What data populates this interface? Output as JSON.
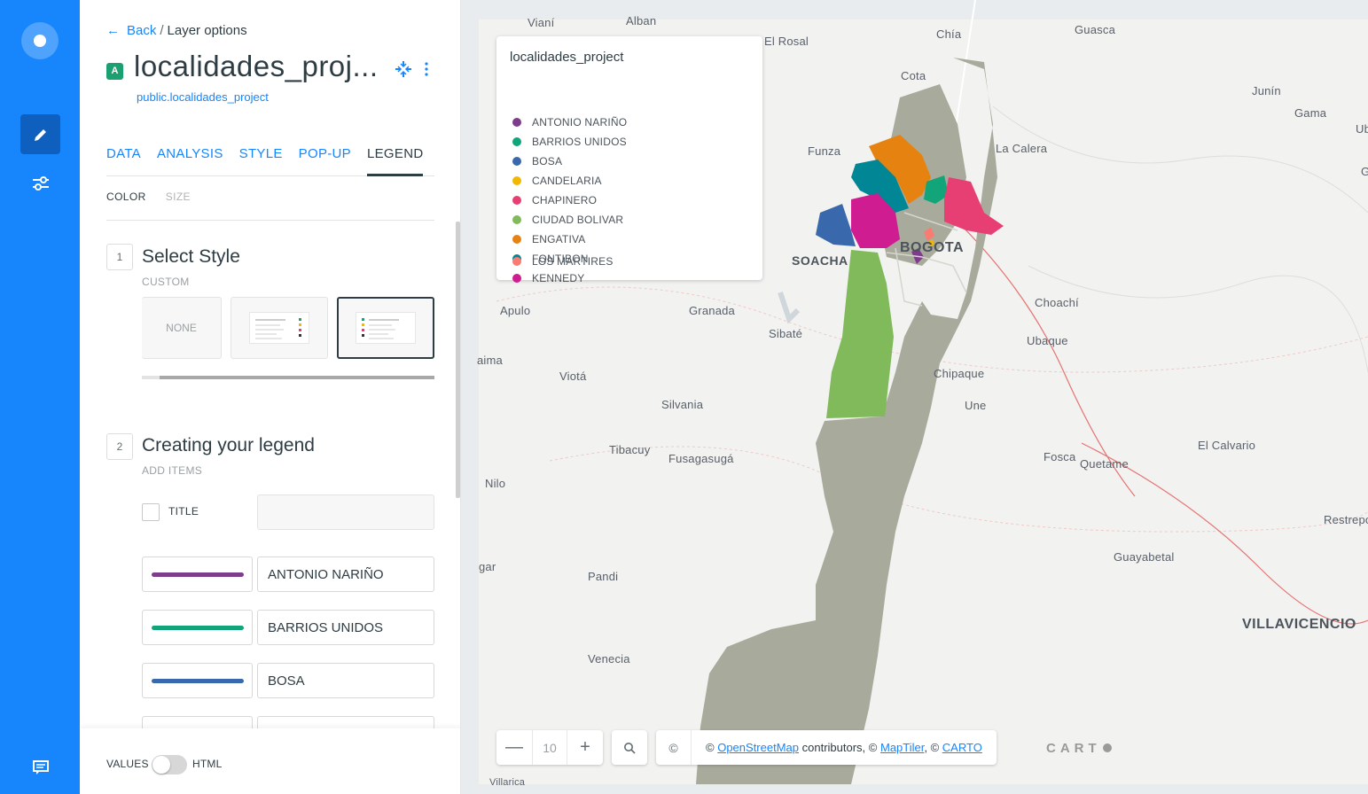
{
  "breadcrumb": {
    "back": "Back",
    "separator": "/",
    "current": "Layer options"
  },
  "layer": {
    "badge": "A",
    "name": "localidades_proj...",
    "source": "public.localidades_project"
  },
  "tabs": [
    {
      "label": "DATA",
      "active": false
    },
    {
      "label": "ANALYSIS",
      "active": false
    },
    {
      "label": "STYLE",
      "active": false
    },
    {
      "label": "POP-UP",
      "active": false
    },
    {
      "label": "LEGEND",
      "active": true
    }
  ],
  "subtabs": [
    {
      "label": "COLOR",
      "active": true
    },
    {
      "label": "SIZE",
      "active": false
    }
  ],
  "step1": {
    "number": "1",
    "title": "Select Style",
    "subtitle": "CUSTOM",
    "none_label": "NONE"
  },
  "step2": {
    "number": "2",
    "title": "Creating your legend",
    "subtitle": "ADD ITEMS",
    "title_checkbox_label": "TITLE"
  },
  "legend_items": [
    {
      "label": "ANTONIO NARIÑO",
      "color": "#7f3c8d"
    },
    {
      "label": "BARRIOS UNIDOS",
      "color": "#11a579"
    },
    {
      "label": "BOSA",
      "color": "#3969ac"
    }
  ],
  "footer": {
    "values_label": "VALUES",
    "html_label": "HTML"
  },
  "map_legend": {
    "title": "localidades_project",
    "items": [
      {
        "label": "ANTONIO NARIÑO",
        "color": "#7f3c8d"
      },
      {
        "label": "BARRIOS UNIDOS",
        "color": "#11a579"
      },
      {
        "label": "BOSA",
        "color": "#3969ac"
      },
      {
        "label": "CANDELARIA",
        "color": "#f2b701"
      },
      {
        "label": "CHAPINERO",
        "color": "#e73f74"
      },
      {
        "label": "CIUDAD BOLIVAR",
        "color": "#80ba5a"
      },
      {
        "label": "ENGATIVA",
        "color": "#e68310"
      },
      {
        "label": "FONTIBON",
        "color": "#008695"
      },
      {
        "label": "KENNEDY",
        "color": "#cf1c90"
      },
      {
        "label": "LOS MARTIRES",
        "color": "#f97b72"
      }
    ]
  },
  "map_controls": {
    "zoom_out": "—",
    "zoom_level": "10",
    "zoom_in": "+",
    "copyright_symbol": "©",
    "attribution_prefix": "©",
    "osm_link": "OpenStreetMap",
    "contributors": "contributors, ©",
    "maptiler_link": "MapTiler",
    "comma": ", ©",
    "carto_link": "CARTO",
    "carto_logo": "CART"
  },
  "places": [
    {
      "name": "Vianí"
    },
    {
      "name": "Alban"
    },
    {
      "name": "El Rosal"
    },
    {
      "name": "Chía"
    },
    {
      "name": "Guasca"
    },
    {
      "name": "Cota"
    },
    {
      "name": "Junín"
    },
    {
      "name": "Gama"
    },
    {
      "name": "Ub"
    },
    {
      "name": "Funza"
    },
    {
      "name": "La Calera"
    },
    {
      "name": "G"
    },
    {
      "name": "BOGOTA"
    },
    {
      "name": "SOACHA"
    },
    {
      "name": "Apulo"
    },
    {
      "name": "Granada"
    },
    {
      "name": "Choachí"
    },
    {
      "name": "Sibaté"
    },
    {
      "name": "Ubaque"
    },
    {
      "name": "aima"
    },
    {
      "name": "Viotá"
    },
    {
      "name": "Chipaque"
    },
    {
      "name": "Silvania"
    },
    {
      "name": "Une"
    },
    {
      "name": "Tibacuy"
    },
    {
      "name": "Fusagasugá"
    },
    {
      "name": "Fosca"
    },
    {
      "name": "Quetame"
    },
    {
      "name": "El Calvario"
    },
    {
      "name": "Nilo"
    },
    {
      "name": "Restrepo"
    },
    {
      "name": "gar"
    },
    {
      "name": "Guayabetal"
    },
    {
      "name": "Pandi"
    },
    {
      "name": "VILLAVICENCIO"
    },
    {
      "name": "Venecia"
    },
    {
      "name": "Villarica"
    }
  ]
}
